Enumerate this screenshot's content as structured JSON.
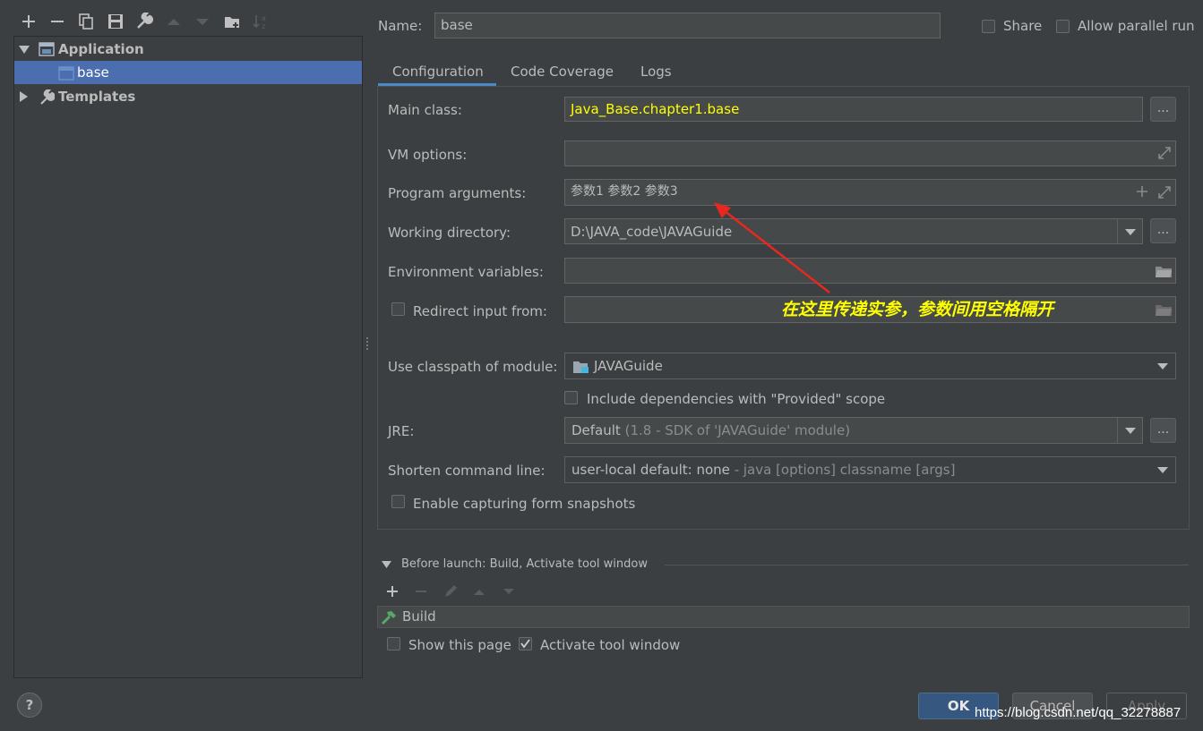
{
  "toolbar": {
    "icons": [
      "plus-icon",
      "minus-icon",
      "copy-icon",
      "save-icon",
      "wrench-icon",
      "arrow-up-icon",
      "arrow-down-icon",
      "folder-add-icon",
      "sort-icon"
    ]
  },
  "tree": {
    "application": "Application",
    "base": "base",
    "templates": "Templates"
  },
  "header": {
    "name_label": "Name:",
    "name_value": "base",
    "share_label": "Share",
    "parallel_label": "Allow parallel run"
  },
  "tabs": [
    "Configuration",
    "Code Coverage",
    "Logs"
  ],
  "form": {
    "main_class_label": "Main class:",
    "main_class_value": "Java_Base.chapter1.base",
    "vm_options_label": "VM options:",
    "vm_options_value": "",
    "program_args_label": "Program arguments:",
    "program_args_value": "参数1 参数2 参数3",
    "working_dir_label": "Working directory:",
    "working_dir_value": "D:\\JAVA_code\\JAVAGuide",
    "env_vars_label": "Environment variables:",
    "env_vars_value": "",
    "redirect_label": "Redirect input from:",
    "classpath_label": "Use classpath of module:",
    "classpath_value": "JAVAGuide",
    "include_deps_label": "Include dependencies with \"Provided\" scope",
    "jre_label": "JRE:",
    "jre_value": "Default",
    "jre_detail": "(1.8 - SDK of 'JAVAGuide' module)",
    "shorten_label": "Shorten command line:",
    "shorten_value": "user-local default: none",
    "shorten_detail": "- java [options] classname [args]",
    "snapshots_label": "Enable capturing form snapshots"
  },
  "annotation": {
    "text": "在这里传递实参，参数间用空格隔开",
    "color": "#ffff00",
    "arrow_color": "#e8281f"
  },
  "before_launch": {
    "title": "Before launch: Build, Activate tool window",
    "task": "Build",
    "show_page_label": "Show this page",
    "activate_label": "Activate tool window"
  },
  "buttons": {
    "ok": "OK",
    "cancel": "Cancel",
    "apply": "Apply",
    "help": "?"
  },
  "watermark": "https://blog.csdn.net/qq_32278887",
  "colors": {
    "background": "#3c3f41",
    "selection": "#4b6eaf",
    "main_class_text": "#ffff00",
    "ok_button": "#365880"
  }
}
